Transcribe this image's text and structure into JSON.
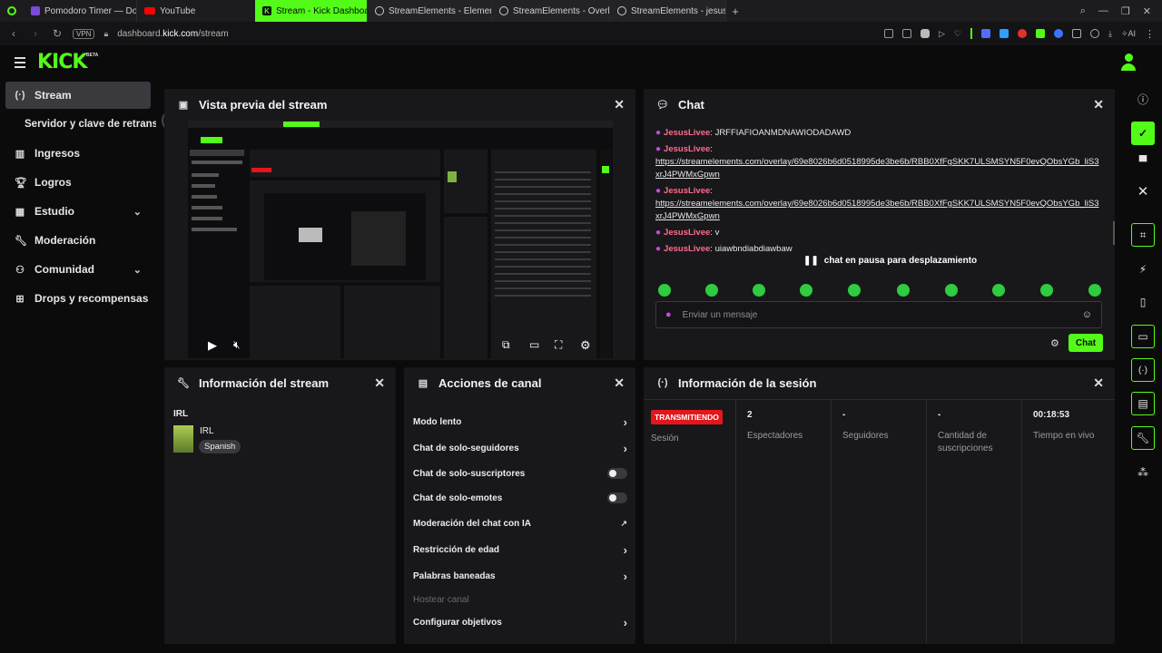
{
  "browser": {
    "tabs": [
      {
        "label": "Pomodoro Timer — Do",
        "icon": "timer-icon",
        "active": false
      },
      {
        "label": "YouTube",
        "icon": "youtube-icon",
        "active": false
      },
      {
        "label": "Stream - Kick Dashboard",
        "icon": "kick-icon",
        "active": true
      },
      {
        "label": "StreamElements - Elemen",
        "icon": "streamelements-icon",
        "active": false
      },
      {
        "label": "StreamElements - Overlay",
        "icon": "streamelements-icon",
        "active": false
      },
      {
        "label": "StreamElements - jesuslive",
        "icon": "streamelements-icon",
        "active": false
      }
    ],
    "url_prefix": "dashboard.",
    "url_host": "kick.com",
    "url_path": "/stream",
    "vpn_label": "VPN",
    "ai_label": "AI"
  },
  "header": {
    "logo": "KICK",
    "beta": "BETA"
  },
  "sidebar": {
    "items": [
      {
        "label": "Stream",
        "icon": "broadcast-icon"
      },
      {
        "label": "Servidor y clave de retransm",
        "icon": ""
      },
      {
        "label": "Ingresos",
        "icon": "chart-icon"
      },
      {
        "label": "Logros",
        "icon": "trophy-icon"
      },
      {
        "label": "Estudio",
        "icon": "studio-icon"
      },
      {
        "label": "Moderación",
        "icon": "wrench-icon"
      },
      {
        "label": "Comunidad",
        "icon": "community-icon"
      },
      {
        "label": "Drops y recompensas",
        "icon": "gift-icon"
      }
    ]
  },
  "preview": {
    "title": "Vista previa del stream"
  },
  "chat": {
    "title": "Chat",
    "messages": [
      {
        "user": "JesusLivee",
        "text": "JRFFIAFIOANMDNAWIODADAWD",
        "link": false
      },
      {
        "user": "JesusLivee",
        "text": "https://streamelements.com/overlay/69e8026b6d0518995de3be6b/RBB0XfFgSKK7ULSMSYN5F0evQObsYGb_liS3xrJ4PWMxGpwn",
        "link": true
      },
      {
        "user": "JesusLivee",
        "text": "https://streamelements.com/overlay/69e8026b6d0518995de3be6b/RBB0XfFgSKK7ULSMSYN5F0evQObsYGb_liS3xrJ4PWMxGpwn",
        "link": true
      },
      {
        "user": "JesusLivee",
        "text": "v",
        "link": false
      },
      {
        "user": "JesusLivee",
        "text": "uiawbndiabdiawbaw",
        "link": false
      }
    ],
    "paused_label": "chat en pausa para desplazamiento",
    "input_placeholder": "Enviar un mensaje",
    "send_label": "Chat"
  },
  "stream_info": {
    "title": "Información del stream",
    "heading": "IRL",
    "category": "IRL",
    "language": "Spanish"
  },
  "channel_actions": {
    "title": "Acciones de canal",
    "items": [
      {
        "label": "Modo lento",
        "control": "chevron"
      },
      {
        "label": "Chat de solo-seguidores",
        "control": "chevron"
      },
      {
        "label": "Chat de solo-suscriptores",
        "control": "toggle"
      },
      {
        "label": "Chat de solo-emotes",
        "control": "toggle"
      },
      {
        "label": "Moderación del chat con IA",
        "control": "external"
      },
      {
        "label": "Restricción de edad",
        "control": "chevron"
      },
      {
        "label": "Palabras baneadas",
        "control": "chevron"
      },
      {
        "label": "Hostear canal",
        "control": "disabled"
      },
      {
        "label": "Configurar objetivos",
        "control": "chevron"
      }
    ]
  },
  "session": {
    "title": "Información de la sesión",
    "status_badge": "TRANSMITIENDO",
    "status_label": "Sesión",
    "stats": [
      {
        "value": "2",
        "label": "Espectadores"
      },
      {
        "value": "-",
        "label": "Seguidores"
      },
      {
        "value": "-",
        "label": "Cantidad de suscripciones"
      },
      {
        "value": "00:18:53",
        "label": "Tiempo en vivo"
      }
    ]
  },
  "colors": {
    "accent": "#53fc18",
    "badge": "#e4161b",
    "username": "#ff6b8a"
  }
}
